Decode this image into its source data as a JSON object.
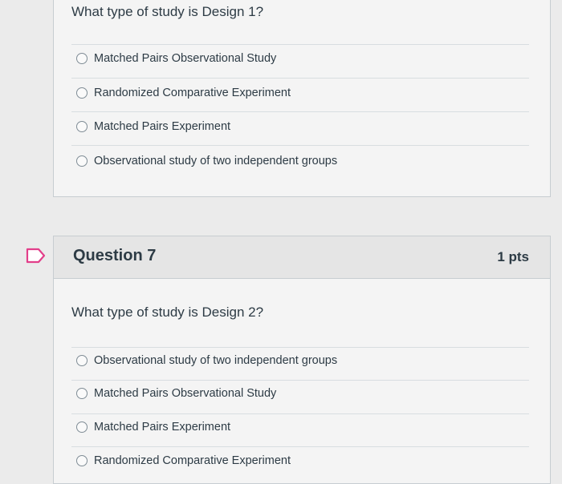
{
  "question6": {
    "prompt": "What type of study is Design 1?",
    "options": [
      {
        "label": "Matched Pairs Observational Study"
      },
      {
        "label": "Randomized Comparative Experiment"
      },
      {
        "label": "Matched Pairs Experiment"
      },
      {
        "label": "Observational study of two independent groups"
      }
    ]
  },
  "question7": {
    "title": "Question 7",
    "points": "1 pts",
    "prompt": "What type of study is Design 2?",
    "options": [
      {
        "label": "Observational study of two independent groups"
      },
      {
        "label": "Matched Pairs Observational Study"
      },
      {
        "label": "Matched Pairs Experiment"
      },
      {
        "label": "Randomized Comparative Experiment"
      }
    ]
  },
  "icons": {
    "bookmark": "bookmark-flag-icon",
    "radio": "radio-unselected"
  },
  "colors": {
    "background": "#ebebeb",
    "card": "#f4f4f4",
    "header": "#e5e5e5",
    "text": "#2d3b45",
    "bookmark_accent": "#e23f8a"
  }
}
